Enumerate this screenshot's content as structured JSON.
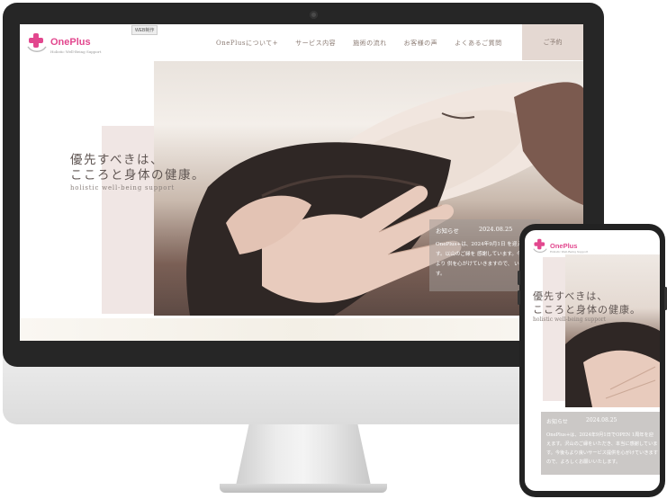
{
  "brand": {
    "name": "OnePlus",
    "tagline_small": "Holistic Well-Being Support",
    "accent_color": "#e2478e"
  },
  "badge": {
    "label": "WEB制作"
  },
  "nav": {
    "items": [
      {
        "label": "OnePlusについて+"
      },
      {
        "label": "サービス内容"
      },
      {
        "label": "施術の流れ"
      },
      {
        "label": "お客様の声"
      },
      {
        "label": "よくあるご質問"
      }
    ],
    "reserve_label": "ご予約"
  },
  "hero": {
    "headline_line1": "優先すべきは、",
    "headline_line2": "こころと身体の健康。",
    "subline": "holistic well-being support"
  },
  "news": {
    "heading": "お知らせ",
    "date": "2024.08.25",
    "body_desktop": "OnePlus+は、2024年9月1日 を迎えます。以山のご縁を 感謝しています。今後もより 供を心がけていきますので、 いたします。",
    "body_mobile": "OnePlus+は、2024年9月1日でOPEN 1周年を迎えます。沢山のご縁をいただき、本当に感謝しています。今後もより良いサービス提供を心がけていきますので、よろしくお願いいたします。"
  },
  "icons": {
    "logo": "plus-logo-icon",
    "camera": "camera-icon"
  }
}
